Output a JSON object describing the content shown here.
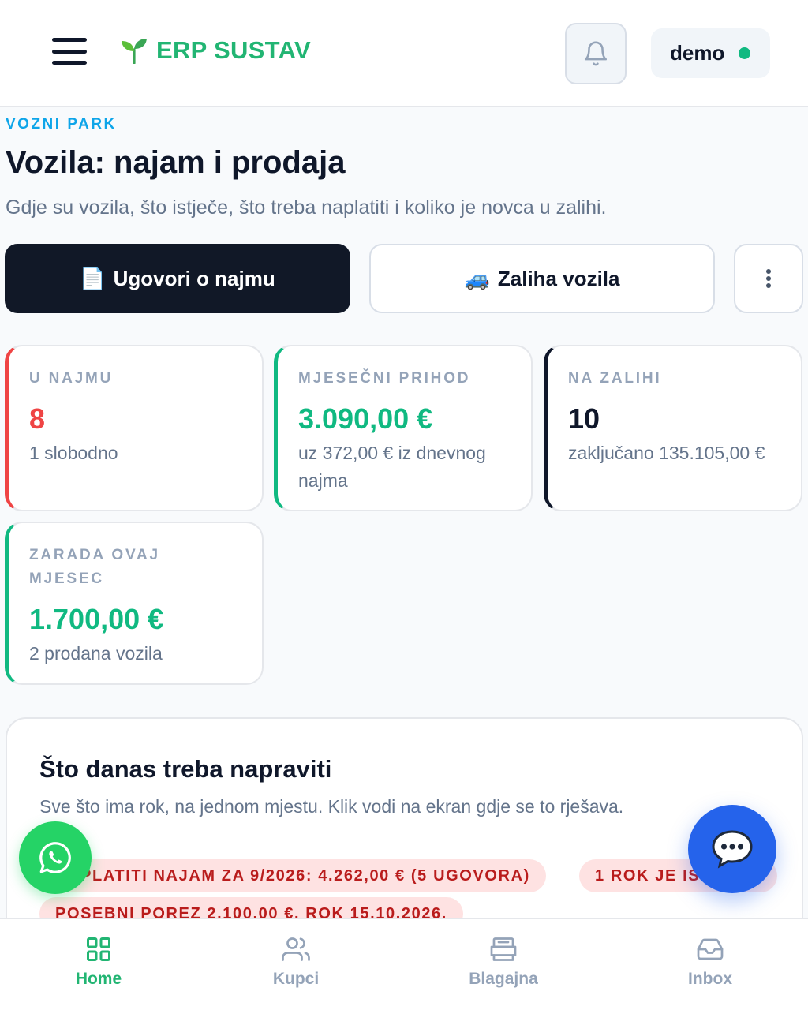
{
  "header": {
    "brand_name": "ERP SUSTAV",
    "brand_icon": "seedling-icon",
    "user_name": "demo",
    "user_status_color": "#10b981"
  },
  "page": {
    "eyebrow": "VOZNI PARK",
    "title": "Vozila: najam i prodaja",
    "subtitle": "Gdje su vozila, što istječe, što treba naplatiti i koliko je novca u zalihi."
  },
  "actions": {
    "primary_emoji": "📄",
    "primary_label": "Ugovori o najmu",
    "secondary_emoji": "🚙",
    "secondary_label": "Zaliha vozila",
    "more_icon": "more-vertical-icon"
  },
  "stats": [
    {
      "label": "U NAJMU",
      "value": "8",
      "note": "1 slobodno",
      "accent": "#ef4444"
    },
    {
      "label": "MJESEČNI PRIHOD",
      "value": "3.090,00 €",
      "note": "uz 372,00 € iz dnevnog najma",
      "accent": "#10b981"
    },
    {
      "label": "NA ZALIHI",
      "value": "10",
      "note": "zaključano 135.105,00 €",
      "accent": "#0f172a"
    },
    {
      "label": "ZARADA OVAJ MJESEC",
      "value": "1.700,00 €",
      "note": "2 prodana vozila",
      "accent": "#10b981"
    }
  ],
  "todo": {
    "title": "Što danas treba napraviti",
    "subtitle": "Sve što ima rok, na jednom mjestu. Klik vodi na ekran gdje se to rješava.",
    "chips": [
      "NAPLATITI NAJAM ZA 9/2026: 4.262,00 € (5 UGOVORA)",
      "1 ROK JE ISTEKAO",
      "POSEBNI POREZ 2.100,00 €. ROK 15.10.2026."
    ]
  },
  "bottom_nav": [
    {
      "label": "Home",
      "icon": "grid-icon",
      "active": true
    },
    {
      "label": "Kupci",
      "icon": "users-icon",
      "active": false
    },
    {
      "label": "Blagajna",
      "icon": "cash-register-icon",
      "active": false
    },
    {
      "label": "Inbox",
      "icon": "inbox-icon",
      "active": false
    }
  ],
  "colors": {
    "brand": "#22b573",
    "accent_blue": "#0ea5e9",
    "chat_fab": "#2563eb",
    "whatsapp_fab": "#25d366",
    "chip_bg": "#fee2e2",
    "chip_text": "#b91c1c"
  }
}
